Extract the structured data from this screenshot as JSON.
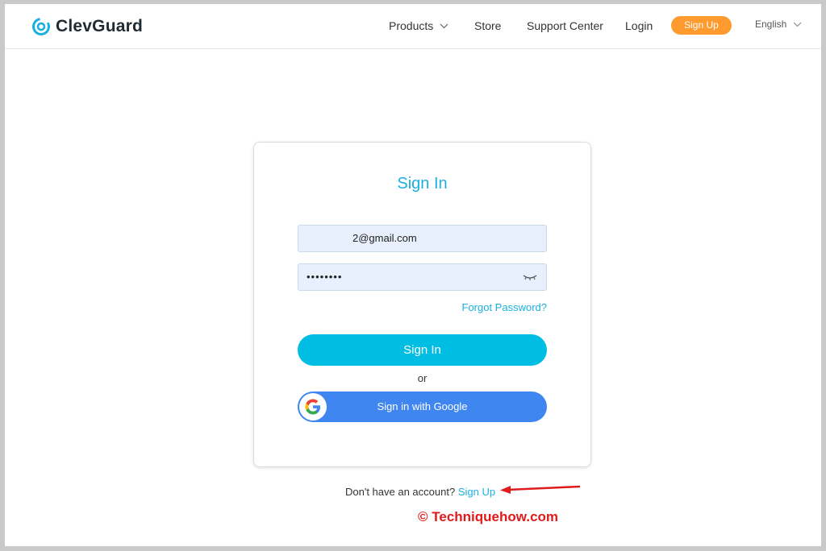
{
  "brand": {
    "name": "ClevGuard",
    "accent": "#1ab0e0"
  },
  "nav": {
    "products": "Products",
    "store": "Store",
    "support": "Support Center",
    "login": "Login",
    "signup": "Sign Up",
    "language": "English"
  },
  "signin": {
    "title": "Sign In",
    "email_value": "2@gmail.com",
    "password_value": "••••••••",
    "forgot": "Forgot Password?",
    "submit": "Sign In",
    "or": "or",
    "google": "Sign in with Google"
  },
  "footer": {
    "no_account": "Don't have an account?",
    "signup_link": "Sign Up"
  },
  "watermark": "© Techniquehow.com",
  "colors": {
    "signup_pill": "#ff9a2e",
    "signin_button": "#00bde3",
    "google_button": "#3f86f0",
    "annotation": "#e01b1b"
  }
}
